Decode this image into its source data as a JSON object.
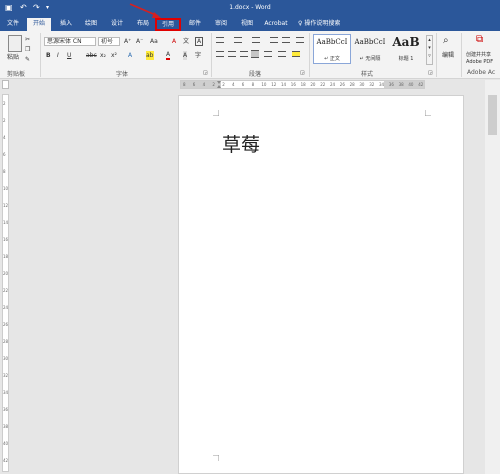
{
  "title_bar": {
    "doc_title": "1.docx - Word",
    "save_icon": "save-icon",
    "undo_icon": "undo-icon",
    "redo_icon": "redo-icon",
    "customize_icon": "customize-qat-icon"
  },
  "tabs": [
    "文件",
    "开始",
    "插入",
    "绘图",
    "设计",
    "布局",
    "引用",
    "邮件",
    "审阅",
    "视图",
    "Acrobat"
  ],
  "active_tab": "开始",
  "highlighted_tab": "引用",
  "tell_me": "操作说明搜索",
  "clipboard": {
    "paste_label": "粘贴",
    "group_label": "剪贴板"
  },
  "font": {
    "family": "思源宋体 CN",
    "size": "初号",
    "grow": "A⁺",
    "shrink": "A⁻",
    "change_case": "Aa",
    "clear_format": "A",
    "pinyin": "文",
    "border_char": "A",
    "bold": "B",
    "italic": "I",
    "underline": "U",
    "strikethrough": "abc",
    "subscript": "x₂",
    "superscript": "x²",
    "text_effect": "A",
    "highlight": "ab",
    "font_color": "A",
    "shading": "A",
    "char_circle": "字",
    "group_label": "字体"
  },
  "paragraph": {
    "group_label": "段落"
  },
  "styles": {
    "items": [
      {
        "preview": "AaBbCcI",
        "name": "↵ 正文"
      },
      {
        "preview": "AaBbCcI",
        "name": "↵ 无间隔"
      },
      {
        "preview": "AaB",
        "name": "标题 1"
      }
    ],
    "group_label": "样式"
  },
  "editing": {
    "label": "编辑"
  },
  "acrobat": {
    "create_label": "创建并共享",
    "pdf_label": "Adobe PDF",
    "group_label": "Adobe Ac"
  },
  "ruler_top": [
    "8",
    "6",
    "4",
    "2",
    "2",
    "4",
    "6",
    "8",
    "10",
    "12",
    "14",
    "16",
    "18",
    "20",
    "22",
    "24",
    "26",
    "28",
    "30",
    "32",
    "34",
    "36",
    "38",
    "40",
    "42"
  ],
  "ruler_left": [
    "2",
    "2",
    "4",
    "6",
    "8",
    "10",
    "12",
    "14",
    "16",
    "18",
    "20",
    "22",
    "24",
    "26",
    "28",
    "30",
    "32",
    "34",
    "36",
    "38",
    "40",
    "42"
  ],
  "document": {
    "text": "草莓"
  },
  "colors": {
    "accent": "#2b579a",
    "highlight_box": "#e00000",
    "annotation_arrow": "#d62020"
  }
}
